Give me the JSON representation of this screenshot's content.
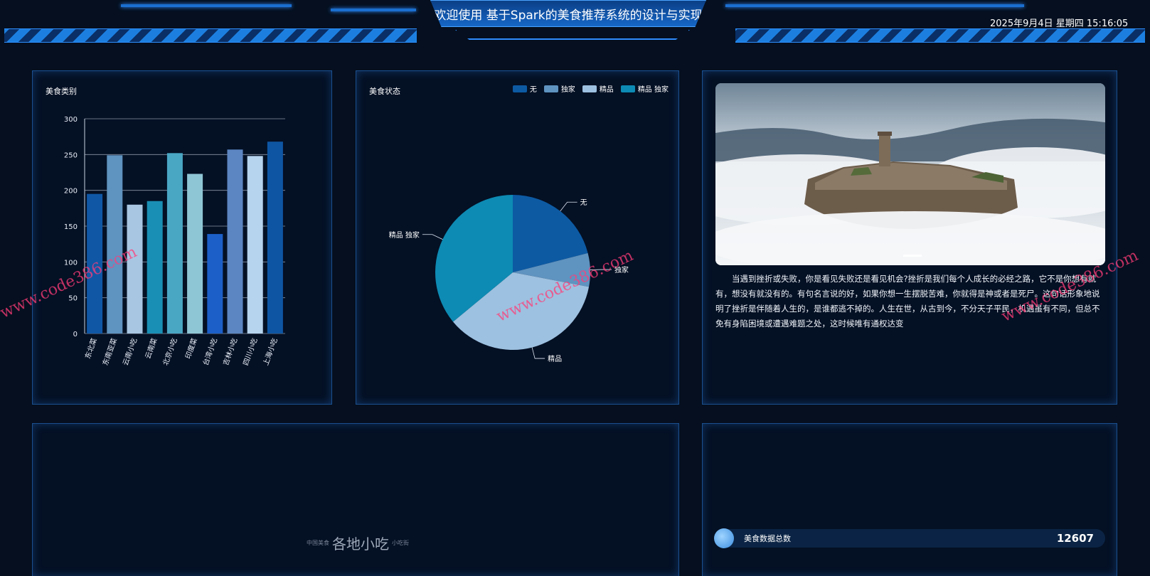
{
  "header": {
    "title": "欢迎使用 基于Spark的美食推荐系统的设计与实现",
    "datetime": "2025年9月4日 星期四 15:16:05"
  },
  "category_panel": {
    "title": "美食类别"
  },
  "status_panel": {
    "title": "美食状态"
  },
  "intro_panel": {
    "paragraph": "当遇到挫折或失败，你是看见失败还是看见机会?挫折是我们每个人成长的必经之路，它不是你想有就有，想没有就没有的。有句名言说的好，如果你想一生摆脱苦难，你就得是神或者是死尸。这句话形象地说明了挫折是伴随着人生的，是谁都逃不掉的。人生在世，从古到今，不分天子平民，机遇虽有不同，但总不免有身陷困境或遭遇难题之处，这时候唯有通权达变"
  },
  "snack_panel": {
    "logo_text": "各地小吃",
    "logo_small_left": "中国美食",
    "logo_small_right": "小吃街"
  },
  "stats_panel": {
    "label": "美食数据总数",
    "value": "12607"
  },
  "watermark": "www.code386.com",
  "colors": {
    "background": "#050f1f",
    "panel_border": "#1a4f8f",
    "accent": "#2f8cff"
  },
  "chart_data": [
    {
      "type": "bar",
      "title": "美食类别",
      "categories": [
        "东北菜",
        "东南亚菜",
        "云南小吃",
        "云南菜",
        "北京小吃",
        "印度菜",
        "台湾小吃",
        "吉林小吃",
        "四川小吃",
        "上海小吃"
      ],
      "values": [
        195,
        249,
        180,
        185,
        252,
        223,
        139,
        257,
        248,
        268
      ],
      "colors": [
        "#1058a6",
        "#5f93c0",
        "#a8c6e2",
        "#1a8fb5",
        "#49a7c4",
        "#8fc6d5",
        "#1c5fc8",
        "#5c86c2",
        "#b6d4ee",
        "#0e56a3"
      ],
      "ylim": [
        0,
        300
      ],
      "yticks": [
        0,
        50,
        100,
        150,
        200,
        250,
        300
      ],
      "grid": true,
      "xlabel": "",
      "ylabel": ""
    },
    {
      "type": "pie",
      "title": "美食状态",
      "labels": [
        "无",
        "独家",
        "精品",
        "精品 独家"
      ],
      "values": [
        21,
        7,
        36,
        36
      ],
      "colors": [
        "#0d5aa3",
        "#5f93c0",
        "#9dc1e0",
        "#0d8bb4"
      ],
      "legend": "top-right"
    }
  ]
}
